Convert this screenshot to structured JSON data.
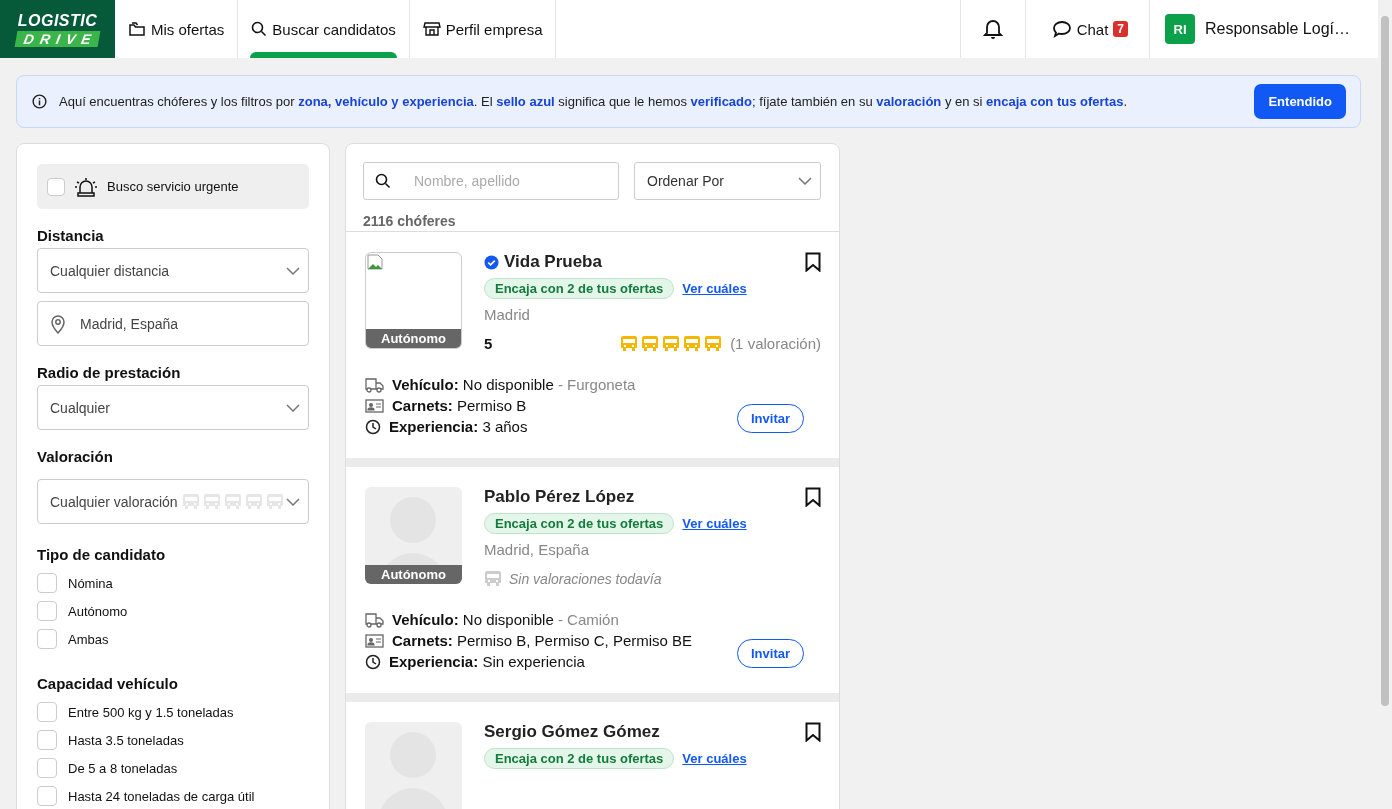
{
  "header": {
    "logo": {
      "top": "LOGISTIC",
      "bottom": "DRIVE"
    },
    "nav": [
      {
        "label": "Mis ofertas",
        "selected": false
      },
      {
        "label": "Buscar candidatos",
        "selected": true
      },
      {
        "label": "Perfil empresa",
        "selected": false
      }
    ],
    "chat": {
      "label": "Chat",
      "badge": "7"
    },
    "user": {
      "initials": "RI",
      "name": "Responsable Logí…"
    }
  },
  "banner": {
    "text": "Aquí encuentras chóferes y los filtros por **zona, vehículo y experiencia**. El **sello azul** significa que le hemos **verificado**; fíjate también en su **valoración** y en si **encaja con tus ofertas**.",
    "button": "Entendido"
  },
  "filters": {
    "urgent": {
      "label": "Busco servicio urgente",
      "checked": false
    },
    "distance": {
      "title": "Distancia",
      "value": "Cualquier distancia",
      "location": "Madrid, España"
    },
    "radius": {
      "title": "Radio de prestación",
      "value": "Cualquier"
    },
    "rating": {
      "title": "Valoración",
      "value": "Cualquier valoración",
      "stars": 0
    },
    "groups": [
      {
        "title": "Tipo de candidato",
        "options": [
          {
            "label": "Nómina",
            "checked": false
          },
          {
            "label": "Autónomo",
            "checked": false
          },
          {
            "label": "Ambas",
            "checked": false
          }
        ]
      },
      {
        "title": "Capacidad vehículo",
        "options": [
          {
            "label": "Entre 500 kg y 1.5 toneladas",
            "checked": false
          },
          {
            "label": "Hasta 3.5 toneladas",
            "checked": false
          },
          {
            "label": "De 5 a 8 toneladas",
            "checked": false
          },
          {
            "label": "Hasta 24 toneladas de carga útil",
            "checked": false
          }
        ]
      }
    ]
  },
  "results": {
    "search": {
      "placeholder": "Nombre, apellido"
    },
    "sort": "Ordenar Por",
    "count": "2116 chóferes",
    "candidates": [
      {
        "name": "Vida Prueba",
        "verified": true,
        "avatar": {
          "kind": "broken"
        },
        "type": "Autónomo",
        "match": "Encaja con 2 de tus ofertas",
        "link": "Ver cuáles",
        "location": "Madrid",
        "rating": {
          "kind": "rated",
          "score": "5",
          "stars": 5,
          "count": "(1 valoración)"
        },
        "details": [
          {
            "kind": "vehicle",
            "text": "**Vehículo:** No disponible",
            "extra": "- Furgoneta"
          },
          {
            "kind": "license",
            "text": "**Carnets:** Permiso B"
          },
          {
            "kind": "experience",
            "text": "**Experiencia:** 3 años"
          }
        ],
        "button": "Invitar"
      },
      {
        "name": "Pablo Pérez López",
        "verified": false,
        "avatar": {
          "kind": "placeholder"
        },
        "type": "Autónomo",
        "match": "Encaja con 2 de tus ofertas",
        "link": "Ver cuáles",
        "location": "Madrid, España",
        "rating": {
          "kind": "none",
          "text": "Sin valoraciones todavía"
        },
        "details": [
          {
            "kind": "vehicle",
            "text": "**Vehículo:** No disponible",
            "extra": "- Camión"
          },
          {
            "kind": "license",
            "text": "**Carnets:** Permiso B, Permiso C, Permiso BE"
          },
          {
            "kind": "experience",
            "text": "**Experiencia:** Sin experiencia"
          }
        ],
        "button": "Invitar"
      },
      {
        "name": "Sergio Gómez Gómez",
        "verified": false,
        "avatar": {
          "kind": "placeholder"
        },
        "match": "Encaja con 2 de tus ofertas",
        "link": "Ver cuáles"
      }
    ]
  }
}
